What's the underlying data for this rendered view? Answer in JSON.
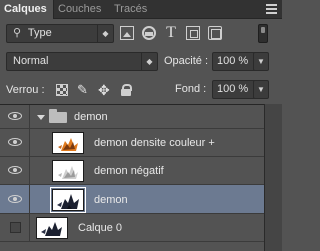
{
  "tabs": [
    {
      "label": "Calques",
      "active": true
    },
    {
      "label": "Couches",
      "active": false
    },
    {
      "label": "Tracés",
      "active": false
    }
  ],
  "filter": {
    "value": "Type",
    "icons": [
      "image-filter-icon",
      "adjustment-filter-icon",
      "text-filter-icon",
      "shape-filter-icon",
      "smart-object-filter-icon"
    ]
  },
  "blend": {
    "value": "Normal"
  },
  "opacity": {
    "label": "Opacité :",
    "value": "100 %"
  },
  "lock": {
    "label": "Verrou :",
    "icons": [
      "lock-pixels-icon",
      "lock-brush-icon",
      "lock-move-icon",
      "lock-all-icon"
    ]
  },
  "fill": {
    "label": "Fond :",
    "value": "100 %"
  },
  "layers": [
    {
      "name": "demon",
      "type": "group",
      "visible": true,
      "expanded": true
    },
    {
      "name": "demon densite couleur +",
      "type": "layer",
      "visible": true
    },
    {
      "name": "demon négatif",
      "type": "layer",
      "visible": true
    },
    {
      "name": "demon",
      "type": "layer",
      "visible": true,
      "selected": true
    },
    {
      "name": "Calque 0",
      "type": "layer",
      "visible": false
    }
  ],
  "colors": {
    "panel": "#535353",
    "selection": "#6c7a91",
    "tabbar": "#323232"
  }
}
